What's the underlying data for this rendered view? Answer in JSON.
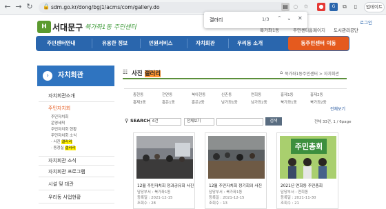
{
  "browser": {
    "url": "sdm.go.kr/dong/bgj1/acms/com/gallery.do",
    "profile_label": "업데이트",
    "find": {
      "query": "갤러리",
      "count": "1/3"
    }
  },
  "site": {
    "logo_mark": "H",
    "logo_name": "서대문구",
    "logo_slogan": "북가좌1동 주민센터",
    "top_links": [
      "로그인",
      "복가좌1동",
      "주민센터",
      "홈페이지",
      "도시관리공단"
    ],
    "gnb": [
      "주민센터안내",
      "유용한 정보",
      "민원서비스",
      "자치회관",
      "우리동 소개"
    ],
    "gnb_button": "동주민센터 이동"
  },
  "lnb": {
    "title": "자치회관",
    "items": [
      "자치회관소개",
      "주민자치회",
      "자치회관 소식",
      "자치회관 프로그램",
      "시설 및 대관",
      "우리동 사업현황"
    ],
    "subitems": [
      "주민자치회",
      "운영세칙",
      "주민자치회 현황",
      "주민자치회 소식",
      "사진 갤러리",
      "동정실 갤러리"
    ]
  },
  "content": {
    "title_prefix": "사진",
    "title_highlight": "갤러리",
    "breadcrumb": "북가좌1동주민센터 > 자치회관",
    "dongs": [
      [
        "충현동",
        "천연동",
        "북아현동",
        "신촌동",
        "연희동",
        "홍제1동",
        "홍제2동"
      ],
      [
        "홍제3동",
        "홍은1동",
        "홍은2동",
        "남가좌1동",
        "남가좌2동",
        "북가좌1동",
        "북가좌2동"
      ]
    ],
    "more": "전체보기",
    "search_label": "SEARCH",
    "search_select1": "6건",
    "search_select2": "전체보기",
    "search_button": "검색",
    "total": "전체 33건, 1 / 6page"
  },
  "cards": [
    {
      "title": "12월 주민자치회 정과공유회 사진",
      "author": "담당부서 : 북가좌1동",
      "date": "등록일 : 2021-12-15",
      "views": "조회수 : 28"
    },
    {
      "title": "12월 주민자치회 정기회의 사진",
      "author": "담당부서 : 북가좌1동",
      "date": "등록일 : 2021-12-15",
      "views": "조회수 : 13"
    },
    {
      "title": "2021년 연희동 주민총회",
      "author": "담당부서 : 연희동",
      "date": "등록일 : 2021-11-30",
      "views": "조회수 : 21"
    }
  ],
  "colors": {
    "gnb": "#2a66ad",
    "accent": "#e55a1e",
    "green": "#5b9a2f"
  }
}
